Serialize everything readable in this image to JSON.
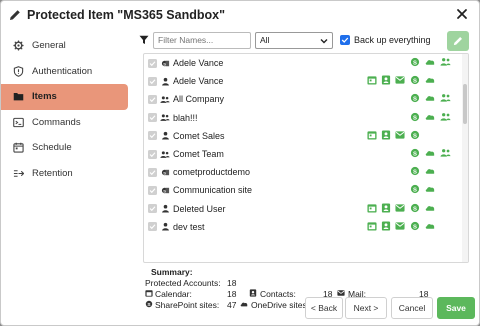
{
  "dialog": {
    "title": "Protected Item \"MS365 Sandbox\""
  },
  "sidebar": {
    "items": [
      {
        "label": "General",
        "icon": "gear-icon"
      },
      {
        "label": "Authentication",
        "icon": "shield-icon"
      },
      {
        "label": "Items",
        "icon": "folder-icon",
        "active": true
      },
      {
        "label": "Commands",
        "icon": "terminal-icon"
      },
      {
        "label": "Schedule",
        "icon": "calendar-icon"
      },
      {
        "label": "Retention",
        "icon": "retention-icon"
      }
    ]
  },
  "filter": {
    "placeholder": "Filter Names...",
    "type_value": "All",
    "backup_everything_label": "Back up everything",
    "backup_everything_checked": true
  },
  "items": [
    {
      "name": "Adele Vance",
      "type": "sharepoint",
      "services": [
        "sharepoint",
        "onedrive",
        "teams"
      ]
    },
    {
      "name": "Adele Vance",
      "type": "user",
      "services": [
        "calendar",
        "contacts",
        "mail",
        "sharepoint",
        "onedrive"
      ]
    },
    {
      "name": "All Company",
      "type": "group",
      "services": [
        "sharepoint",
        "onedrive",
        "teams"
      ]
    },
    {
      "name": "blah!!!",
      "type": "group",
      "services": [
        "sharepoint",
        "onedrive",
        "teams"
      ]
    },
    {
      "name": "Comet Sales",
      "type": "user",
      "services": [
        "calendar",
        "contacts",
        "mail",
        "sharepoint"
      ]
    },
    {
      "name": "Comet Team",
      "type": "group",
      "services": [
        "sharepoint",
        "onedrive",
        "teams"
      ]
    },
    {
      "name": "cometproductdemo",
      "type": "sharepoint",
      "services": [
        "sharepoint",
        "onedrive"
      ]
    },
    {
      "name": "Communication site",
      "type": "sharepoint",
      "services": [
        "sharepoint",
        "onedrive"
      ]
    },
    {
      "name": "Deleted User",
      "type": "user",
      "services": [
        "calendar",
        "contacts",
        "mail",
        "sharepoint",
        "onedrive"
      ]
    },
    {
      "name": "dev test",
      "type": "user",
      "services": [
        "calendar",
        "contacts",
        "mail",
        "sharepoint",
        "onedrive"
      ]
    }
  ],
  "summary": {
    "heading": "Summary:",
    "protected_accounts_label": "Protected Accounts:",
    "protected_accounts_value": "18",
    "calendar_label": "Calendar:",
    "calendar_value": "18",
    "contacts_label": "Contacts:",
    "contacts_value": "18",
    "mail_label": "Mail:",
    "mail_value": "18",
    "sharepoint_label": "SharePoint sites:",
    "sharepoint_value": "47",
    "onedrive_label": "OneDrive sites:",
    "onedrive_value": "47"
  },
  "footer": {
    "back_label": "< Back",
    "next_label": "Next >",
    "cancel_label": "Cancel",
    "save_label": "Save"
  },
  "colors": {
    "accent_active": "#e9967a",
    "service_green": "#4caf50",
    "save_green": "#5cb85c",
    "checkbox_blue": "#1f6feb"
  }
}
